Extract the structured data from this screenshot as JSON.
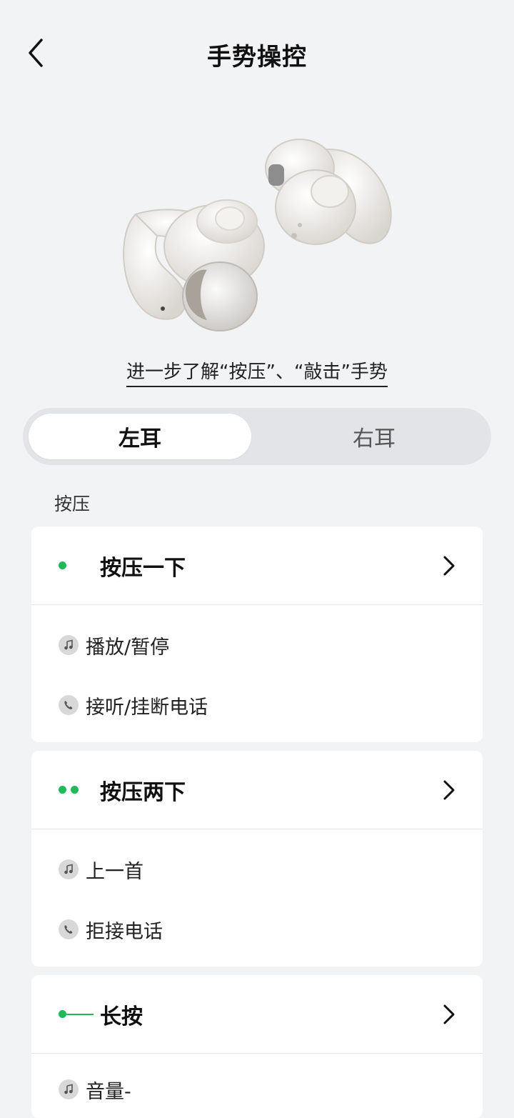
{
  "header": {
    "title": "手势操控"
  },
  "learn_more": "进一步了解“按压”、“敲击”手势",
  "segmented": {
    "left": "左耳",
    "right": "右耳",
    "selected": "left"
  },
  "section": {
    "label": "按压"
  },
  "cards": [
    {
      "title": "按压一下",
      "indicator": "single-dot",
      "rows": [
        {
          "icon": "music-note-icon",
          "label": "播放/暂停"
        },
        {
          "icon": "phone-icon",
          "label": "接听/挂断电话"
        }
      ]
    },
    {
      "title": "按压两下",
      "indicator": "double-dot",
      "rows": [
        {
          "icon": "music-note-icon",
          "label": "上一首"
        },
        {
          "icon": "phone-icon",
          "label": "拒接电话"
        }
      ]
    },
    {
      "title": "长按",
      "indicator": "dot-line",
      "rows": [
        {
          "icon": "music-note-icon",
          "label": "音量-"
        }
      ]
    }
  ],
  "colors": {
    "accent": "#1fba57",
    "background": "#f2f3f5"
  }
}
